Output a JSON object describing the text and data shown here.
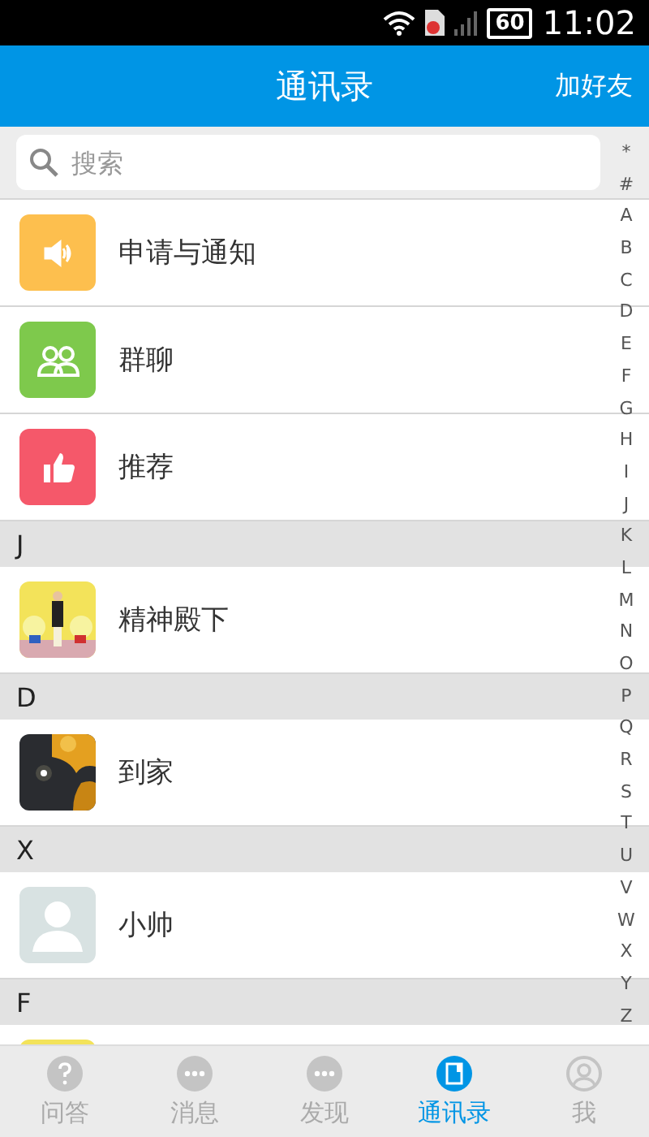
{
  "status_bar": {
    "battery": "60",
    "time": "11:02"
  },
  "header": {
    "title": "通讯录",
    "action": "加好友"
  },
  "search": {
    "placeholder": "搜索"
  },
  "entries": [
    {
      "label": "申请与通知",
      "kind": "speaker",
      "color": "#fdbf4e"
    },
    {
      "label": "群聊",
      "kind": "group",
      "color": "#7ec94c"
    },
    {
      "label": "推荐",
      "kind": "thumb",
      "color": "#f5586a"
    }
  ],
  "sections": [
    {
      "letter": "J",
      "contacts": [
        {
          "name": "精神殿下",
          "kind": "picture"
        }
      ]
    },
    {
      "letter": "D",
      "contacts": [
        {
          "name": "到家",
          "kind": "picture"
        }
      ]
    },
    {
      "letter": "X",
      "contacts": [
        {
          "name": "小帅",
          "kind": "placeholder"
        }
      ]
    },
    {
      "letter": "F"
    }
  ],
  "index": [
    "*",
    "#",
    "A",
    "B",
    "C",
    "D",
    "E",
    "F",
    "G",
    "H",
    "I",
    "J",
    "K",
    "L",
    "M",
    "N",
    "O",
    "P",
    "Q",
    "R",
    "S",
    "T",
    "U",
    "V",
    "W",
    "X",
    "Y",
    "Z"
  ],
  "tabs": [
    {
      "label": "问答",
      "selected": false
    },
    {
      "label": "消息",
      "selected": false
    },
    {
      "label": "发现",
      "selected": false
    },
    {
      "label": "通讯录",
      "selected": true
    },
    {
      "label": "我",
      "selected": false
    }
  ]
}
